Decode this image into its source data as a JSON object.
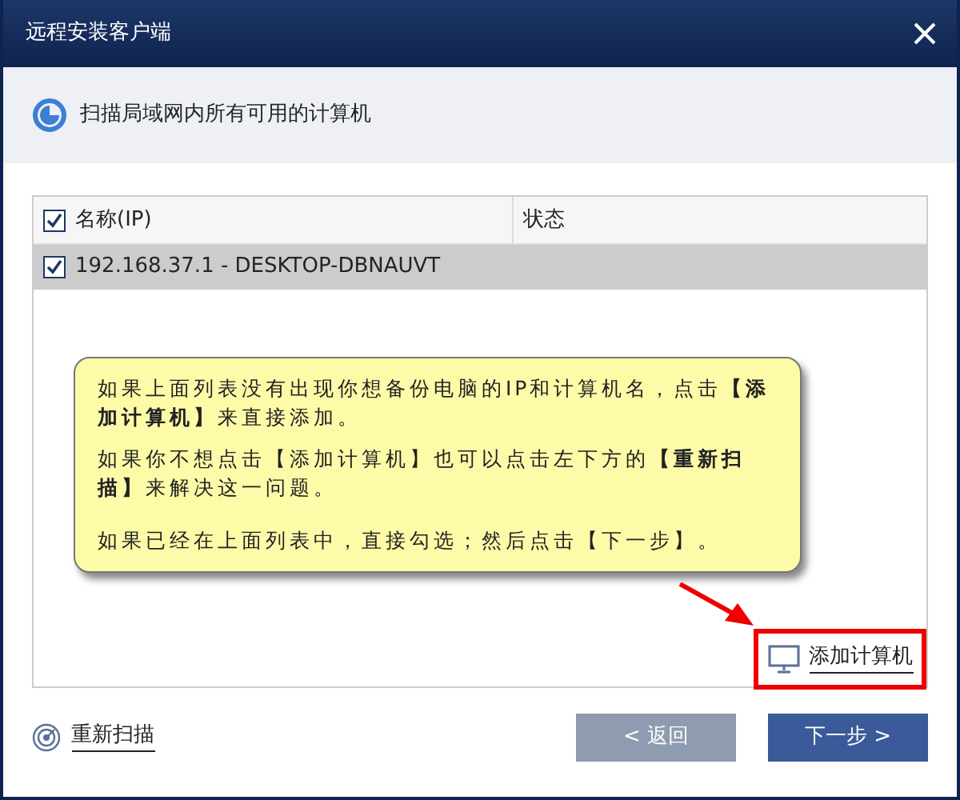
{
  "window": {
    "title": "远程安装客户端"
  },
  "header": {
    "text": "扫描局域网内所有可用的计算机"
  },
  "table": {
    "columns": [
      {
        "label": "名称(IP)",
        "checked": true
      },
      {
        "label": "状态"
      }
    ],
    "rows": [
      {
        "name": "192.168.37.1 - DESKTOP-DBNAUVT",
        "checked": true,
        "selected": true
      }
    ]
  },
  "callout": {
    "paragraphs": [
      "如果上面列表没有出现你想备份电脑的IP和计算机名，点击**【添加计算机】**来直接添加。",
      "如果你不想点击【添加计算机】也可以点击左下方的**【重新扫描】**来解决这一问题。",
      "如果已经在上面列表中，直接勾选；然后点击【下一步】。"
    ]
  },
  "add_computer": {
    "label": "添加计算机",
    "highlighted": true
  },
  "rescan": {
    "label": "重新扫描"
  },
  "buttons": [
    {
      "label": "< 返回",
      "disabled": true
    },
    {
      "label": "下一步 >",
      "disabled": false
    }
  ]
}
